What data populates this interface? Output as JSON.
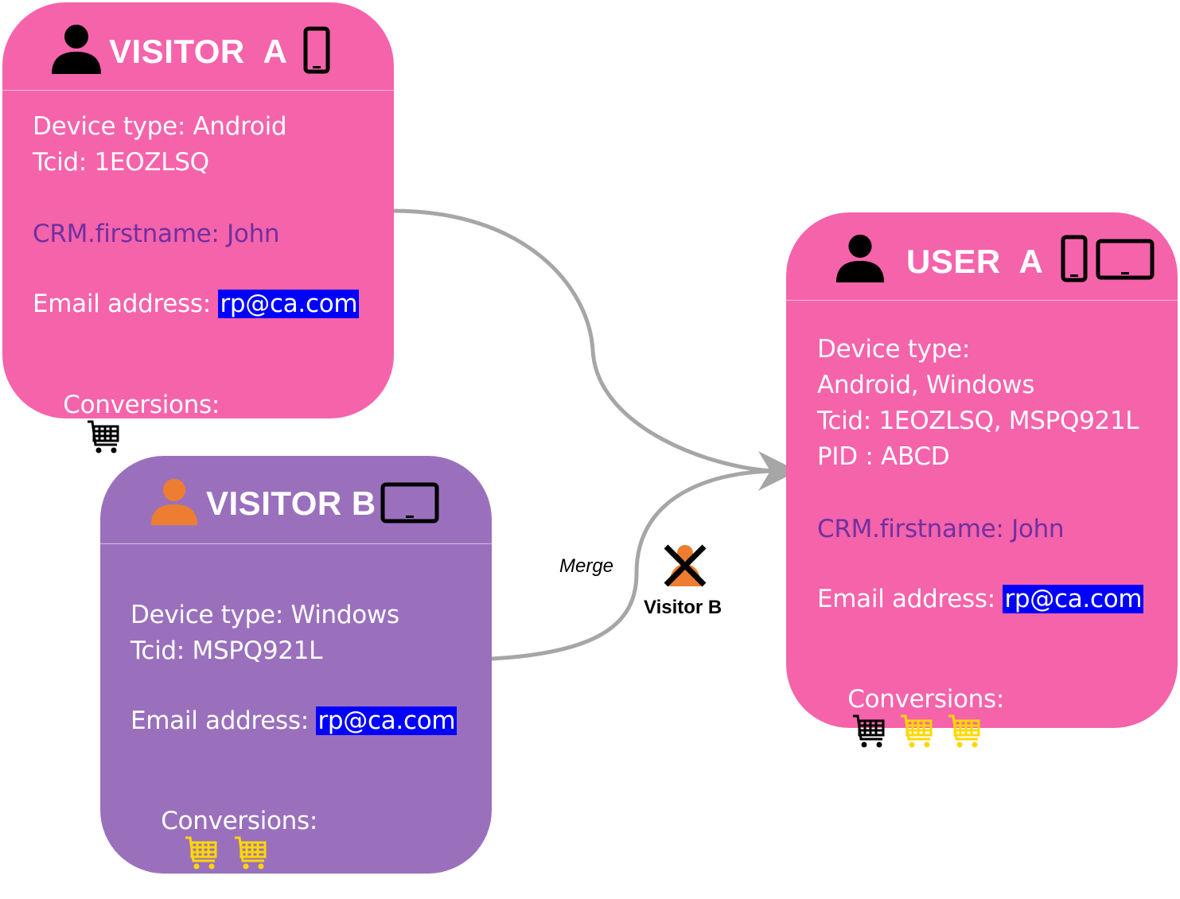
{
  "visitor_a": {
    "title": "VISITOR  A",
    "person_icon": "person-icon",
    "device_icons": [
      "phone-icon"
    ],
    "device_type": "Device type: Android",
    "tcid": "Tcid: 1EOZLSQ",
    "crm_firstname": "CRM.firstname: John",
    "email_label": "Email address: ",
    "email_value": "rp@ca.com",
    "conversions_label": "Conversions:",
    "conversions": [
      "black"
    ]
  },
  "visitor_b": {
    "title": "VISITOR B",
    "person_icon": "person-icon",
    "device_icons": [
      "tablet-icon"
    ],
    "device_type": "Device type: Windows",
    "tcid": "Tcid: MSPQ921L",
    "email_label": "Email address: ",
    "email_value": "rp@ca.com",
    "conversions_label": "Conversions:",
    "conversions": [
      "yellow",
      "yellow"
    ]
  },
  "user_a": {
    "title": "USER  A",
    "person_icon": "person-icon",
    "device_icons": [
      "phone-icon",
      "tablet-icon"
    ],
    "device_type_label": "Device type:",
    "device_type_value": "Android, Windows",
    "tcid": "Tcid: 1EOZLSQ, MSPQ921L",
    "pid": "PID : ABCD",
    "crm_firstname": "CRM.firstname: John",
    "email_label": "Email address: ",
    "email_value": "rp@ca.com",
    "conversions_label": "Conversions:",
    "conversions": [
      "black",
      "yellow",
      "yellow"
    ]
  },
  "merge": {
    "label": "Merge",
    "removed_caption": "Visitor B",
    "removed_icon": "crossed-person-icon"
  },
  "colors": {
    "pink_card": "#f563ab",
    "purple_card": "#9a70bd",
    "crm_text": "#7030a0",
    "email_highlight": "#0000ff",
    "cart_black": "#000000",
    "cart_yellow": "#ffd700",
    "person_orange": "#ed7d31",
    "arrow_gray": "#a6a6a6"
  }
}
